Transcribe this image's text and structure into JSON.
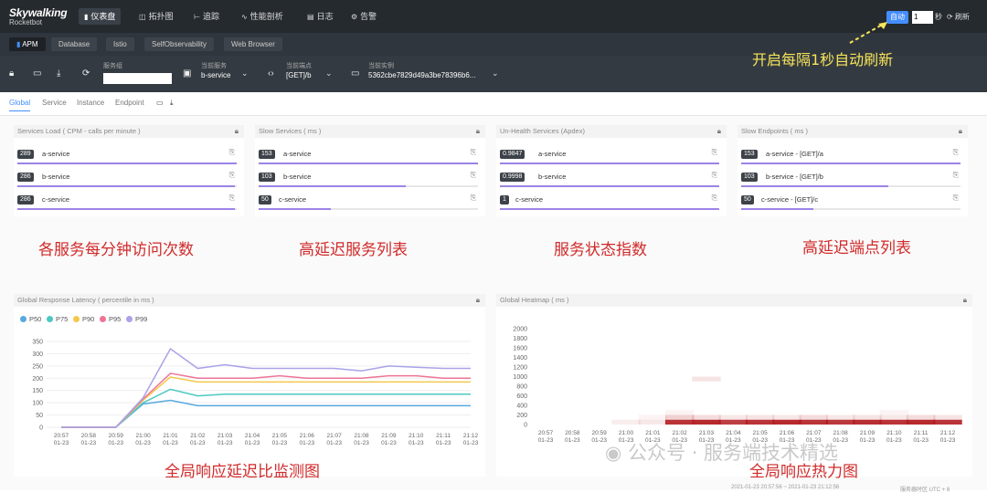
{
  "app": {
    "brand": "Skywalking",
    "sub": "Rocketbot"
  },
  "nav": [
    {
      "icon": "dashboard-icon",
      "glyph": "▮",
      "label": "仪表盘",
      "active": true
    },
    {
      "icon": "topology-icon",
      "glyph": "◫",
      "label": "拓扑图"
    },
    {
      "icon": "trace-icon",
      "glyph": "⊢",
      "label": "追踪"
    },
    {
      "icon": "profile-icon",
      "glyph": "∿",
      "label": "性能剖析"
    },
    {
      "icon": "log-icon",
      "glyph": "▤",
      "label": "日志"
    },
    {
      "icon": "alarm-icon",
      "glyph": "⚙",
      "label": "告警"
    }
  ],
  "auto": {
    "label": "自动",
    "value": "1",
    "unit": "秒",
    "refresh": "刷新"
  },
  "tabs": [
    "APM",
    "Database",
    "Istio",
    "SelfObservability",
    "Web Browser"
  ],
  "selectors": [
    {
      "label": "服务组",
      "value": ""
    },
    {
      "label": "当前服务",
      "value": "b-service"
    },
    {
      "label": "当前端点",
      "value": "[GET]/b"
    },
    {
      "label": "当前实例",
      "value": "5362cbe7829d49a3be78396b6..."
    }
  ],
  "subnav": [
    "Global",
    "Service",
    "Instance",
    "Endpoint"
  ],
  "panels": [
    {
      "title": "Services Load ( CPM - calls per minute )",
      "rows": [
        {
          "num": "289",
          "name": "a-service",
          "frac": 1.0
        },
        {
          "num": "286",
          "name": "b-service",
          "frac": 0.99
        },
        {
          "num": "286",
          "name": "c-service",
          "frac": 0.99
        }
      ]
    },
    {
      "title": "Slow Services ( ms )",
      "rows": [
        {
          "num": "153",
          "name": "a-service",
          "frac": 1.0
        },
        {
          "num": "103",
          "name": "b-service",
          "frac": 0.67
        },
        {
          "num": "50",
          "name": "c-service",
          "frac": 0.33
        }
      ]
    },
    {
      "title": "Un-Health Services (Apdex)",
      "rows": [
        {
          "num": "0.9847",
          "name": "a-service",
          "frac": 1.0
        },
        {
          "num": "0.9998",
          "name": "b-service",
          "frac": 1.0
        },
        {
          "num": "1",
          "name": "c-service",
          "frac": 1.0
        }
      ]
    },
    {
      "title": "Slow Endpoints ( ms )",
      "rows": [
        {
          "num": "153",
          "name": "a-service - [GET]/a",
          "frac": 1.0
        },
        {
          "num": "103",
          "name": "b-service - [GET]/b",
          "frac": 0.67
        },
        {
          "num": "50",
          "name": "c-service - [GET]/c",
          "frac": 0.33
        }
      ]
    }
  ],
  "annotations": {
    "load": "各服务每分钟访问次数",
    "slow": "高延迟服务列表",
    "health": "服务状态指数",
    "endpoints": "高延迟端点列表",
    "latency": "全局响应延迟比监测图",
    "heatmap": "全局响应热力图",
    "auto": "开启每隔1秒自动刷新"
  },
  "watermark": "公众号 · 服务端技术精选",
  "chart_data": [
    {
      "type": "line",
      "title": "Global Response Latency ( percentile in ms )",
      "x": [
        "20:57\n01-23",
        "20:58\n01-23",
        "20:59\n01-23",
        "21:00\n01-23",
        "21:01\n01-23",
        "21:02\n01-23",
        "21:03\n01-23",
        "21:04\n01-23",
        "21:05\n01-23",
        "21:06\n01-23",
        "21:07\n01-23",
        "21:08\n01-23",
        "21:09\n01-23",
        "21:10\n01-23",
        "21:11\n01-23",
        "21:12\n01-23"
      ],
      "ylim": [
        0,
        350
      ],
      "yticks": [
        0,
        50,
        100,
        150,
        200,
        250,
        300,
        350
      ],
      "grid": true,
      "legend": "top-left",
      "series": [
        {
          "name": "P50",
          "color": "#58a8e0",
          "values": [
            0,
            0,
            0,
            95,
            110,
            88,
            88,
            88,
            88,
            88,
            88,
            88,
            88,
            88,
            88,
            88
          ]
        },
        {
          "name": "P75",
          "color": "#4cc9c0",
          "values": [
            0,
            0,
            0,
            100,
            155,
            128,
            135,
            135,
            135,
            135,
            135,
            135,
            135,
            135,
            135,
            135
          ]
        },
        {
          "name": "P90",
          "color": "#f5c84b",
          "values": [
            0,
            0,
            0,
            110,
            205,
            185,
            185,
            185,
            185,
            185,
            185,
            185,
            185,
            185,
            185,
            185
          ]
        },
        {
          "name": "P95",
          "color": "#ee7496",
          "values": [
            0,
            0,
            0,
            115,
            220,
            200,
            200,
            200,
            210,
            200,
            200,
            200,
            210,
            210,
            200,
            200
          ]
        },
        {
          "name": "P99",
          "color": "#a9a3e8",
          "values": [
            0,
            0,
            0,
            120,
            320,
            240,
            255,
            240,
            240,
            240,
            240,
            230,
            250,
            245,
            240,
            240
          ]
        }
      ]
    },
    {
      "type": "heatmap",
      "title": "Global Heatmap ( ms )",
      "x": [
        "20:57\n01-23",
        "20:58\n01-23",
        "20:59\n01-23",
        "21:00\n01-23",
        "21:01\n01-23",
        "21:02\n01-23",
        "21:03\n01-23",
        "21:04\n01-23",
        "21:05\n01-23",
        "21:06\n01-23",
        "21:07\n01-23",
        "21:08\n01-23",
        "21:09\n01-23",
        "21:10\n01-23",
        "21:11\n01-23",
        "21:12\n01-23"
      ],
      "ylim": [
        0,
        2000
      ],
      "yticks": [
        0,
        200,
        400,
        600,
        800,
        1000,
        1200,
        1400,
        1600,
        1800,
        2000
      ],
      "cells": [
        {
          "x": 3,
          "y": 0,
          "v": 0.08
        },
        {
          "x": 4,
          "y": 0,
          "v": 0.1
        },
        {
          "x": 4,
          "y": 100,
          "v": 0.05
        },
        {
          "x": 5,
          "y": 0,
          "v": 0.9
        },
        {
          "x": 6,
          "y": 0,
          "v": 0.95
        },
        {
          "x": 7,
          "y": 0,
          "v": 0.85
        },
        {
          "x": 8,
          "y": 0,
          "v": 0.9
        },
        {
          "x": 9,
          "y": 0,
          "v": 0.95
        },
        {
          "x": 10,
          "y": 0,
          "v": 0.9
        },
        {
          "x": 11,
          "y": 0,
          "v": 0.88
        },
        {
          "x": 12,
          "y": 0,
          "v": 0.92
        },
        {
          "x": 13,
          "y": 0,
          "v": 0.9
        },
        {
          "x": 14,
          "y": 0,
          "v": 0.95
        },
        {
          "x": 15,
          "y": 0,
          "v": 0.9
        },
        {
          "x": 5,
          "y": 100,
          "v": 0.2
        },
        {
          "x": 6,
          "y": 100,
          "v": 0.15
        },
        {
          "x": 7,
          "y": 100,
          "v": 0.1
        },
        {
          "x": 8,
          "y": 100,
          "v": 0.12
        },
        {
          "x": 9,
          "y": 100,
          "v": 0.1
        },
        {
          "x": 10,
          "y": 100,
          "v": 0.15
        },
        {
          "x": 11,
          "y": 100,
          "v": 0.1
        },
        {
          "x": 12,
          "y": 100,
          "v": 0.12
        },
        {
          "x": 13,
          "y": 100,
          "v": 0.1
        },
        {
          "x": 14,
          "y": 100,
          "v": 0.15
        },
        {
          "x": 15,
          "y": 100,
          "v": 0.12
        },
        {
          "x": 5,
          "y": 200,
          "v": 0.05
        },
        {
          "x": 6,
          "y": 900,
          "v": 0.12
        },
        {
          "x": 13,
          "y": 200,
          "v": 0.05
        }
      ]
    }
  ],
  "footer": {
    "left": "2021-01-23 20:57:56 ~ 2021-01-23 21:12:56",
    "right": "服务器时区 UTC + 8"
  }
}
